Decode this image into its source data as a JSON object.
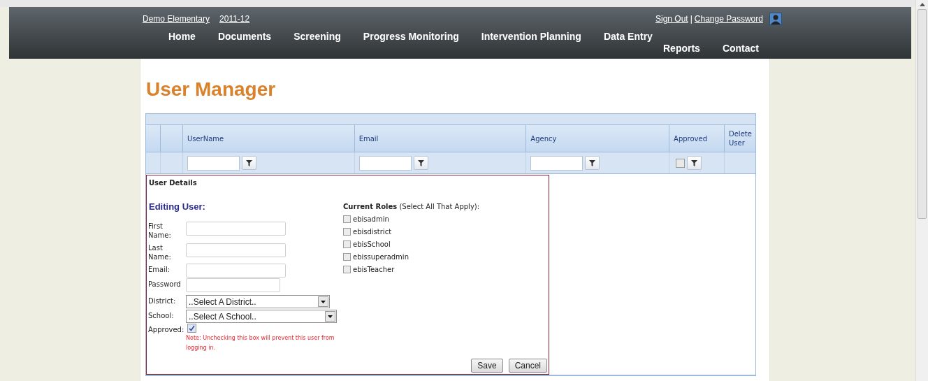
{
  "header": {
    "school": "Demo Elementary",
    "year": "2011-12",
    "account_links": [
      "Sign Out",
      "Change Password"
    ],
    "separator": "|",
    "nav": [
      "Home",
      "Documents",
      "Screening",
      "Progress Monitoring",
      "Intervention Planning",
      "Data Entry",
      "Reports",
      "Contact"
    ]
  },
  "title": "User Manager",
  "grid": {
    "columns": [
      {
        "label": "UserName",
        "kind": "text"
      },
      {
        "label": "Email",
        "kind": "text"
      },
      {
        "label": "Agency",
        "kind": "text"
      },
      {
        "label": "Approved",
        "kind": "checkbox",
        "checked": false
      },
      {
        "label": "Delete User",
        "kind": "none"
      }
    ]
  },
  "form": {
    "heading": "User Details",
    "subheading": "Editing User:",
    "fields": [
      {
        "kind": "text",
        "label": "First Name:"
      },
      {
        "kind": "text",
        "label": "Last Name:"
      },
      {
        "kind": "text",
        "label": "Email:"
      },
      {
        "kind": "password",
        "label": "Password"
      },
      {
        "kind": "select",
        "label": "District:",
        "value": "..Select A District.."
      },
      {
        "kind": "select",
        "label": "School:",
        "value": "..Select A School.."
      },
      {
        "kind": "checkbox",
        "label": "Approved:",
        "checked": true
      }
    ],
    "note": "Note: Unchecking this box will prevent this user from logging in.",
    "roles_heading": "**Current Roles** (Select All That Apply):",
    "roles": [
      {
        "label": "ebisadmin",
        "checked": false
      },
      {
        "label": "ebisdistrict",
        "checked": false
      },
      {
        "label": "ebisSchool",
        "checked": false
      },
      {
        "label": "ebissuperadmin",
        "checked": false
      },
      {
        "label": "ebisTeacher",
        "checked": false
      }
    ],
    "buttons": [
      "Save",
      "Cancel"
    ]
  }
}
